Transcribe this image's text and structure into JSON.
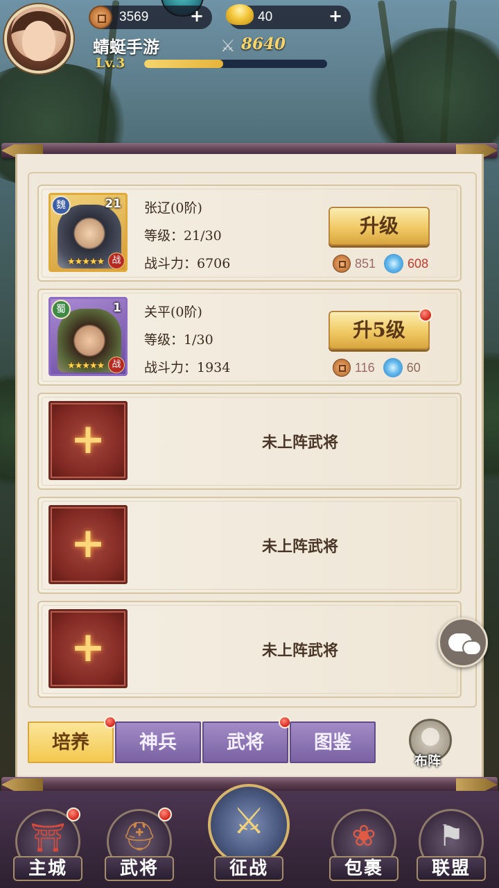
{
  "player": {
    "name": "蜻蜓手游",
    "level": "Lv.3",
    "exp_fraction": 0.43,
    "power": "8640"
  },
  "resources": {
    "copper": "3569",
    "gold": "40"
  },
  "heroes": [
    {
      "name": "张辽(0阶)",
      "faction": "魏",
      "card_level": "21",
      "level": "等级：21/30",
      "power": "战斗力：6706",
      "stars": "★★★★★",
      "battle_tag": "战",
      "upgrade_label": "升级",
      "cost_copper": "851",
      "cost_exp": "608",
      "has_notice": false
    },
    {
      "name": "关平(0阶)",
      "faction": "蜀",
      "card_level": "1",
      "level": "等级：1/30",
      "power": "战斗力：1934",
      "stars": "★★★★★",
      "battle_tag": "战",
      "upgrade_label": "升5级",
      "cost_copper": "116",
      "cost_exp": "60",
      "has_notice": true
    }
  ],
  "empty_slots": [
    {
      "label": "未上阵武将"
    },
    {
      "label": "未上阵武将"
    },
    {
      "label": "未上阵武将"
    }
  ],
  "tabs": [
    {
      "label": "培养",
      "active": true,
      "notice": true
    },
    {
      "label": "神兵",
      "active": false,
      "notice": false
    },
    {
      "label": "武将",
      "active": false,
      "notice": true
    },
    {
      "label": "图鉴",
      "active": false,
      "notice": false
    }
  ],
  "formation_label": "布阵",
  "nav": [
    {
      "label": "主城",
      "notice": true
    },
    {
      "label": "武将",
      "notice": true
    },
    {
      "label": "征战",
      "notice": false
    },
    {
      "label": "包裹",
      "notice": false
    },
    {
      "label": "联盟",
      "notice": false
    }
  ],
  "colors": {
    "active_tab": "#f4c84e",
    "idle_tab": "#7a62a3",
    "exp_cost_insufficient": "#c0392b",
    "notice_dot": "#d4261c"
  },
  "icons": {
    "copper": "copper-coin-icon",
    "gold": "gold-ingot-icon",
    "power": "crossed-swords-icon",
    "exp": "exp-swirl-icon",
    "chat": "chat-bubble-icon"
  }
}
